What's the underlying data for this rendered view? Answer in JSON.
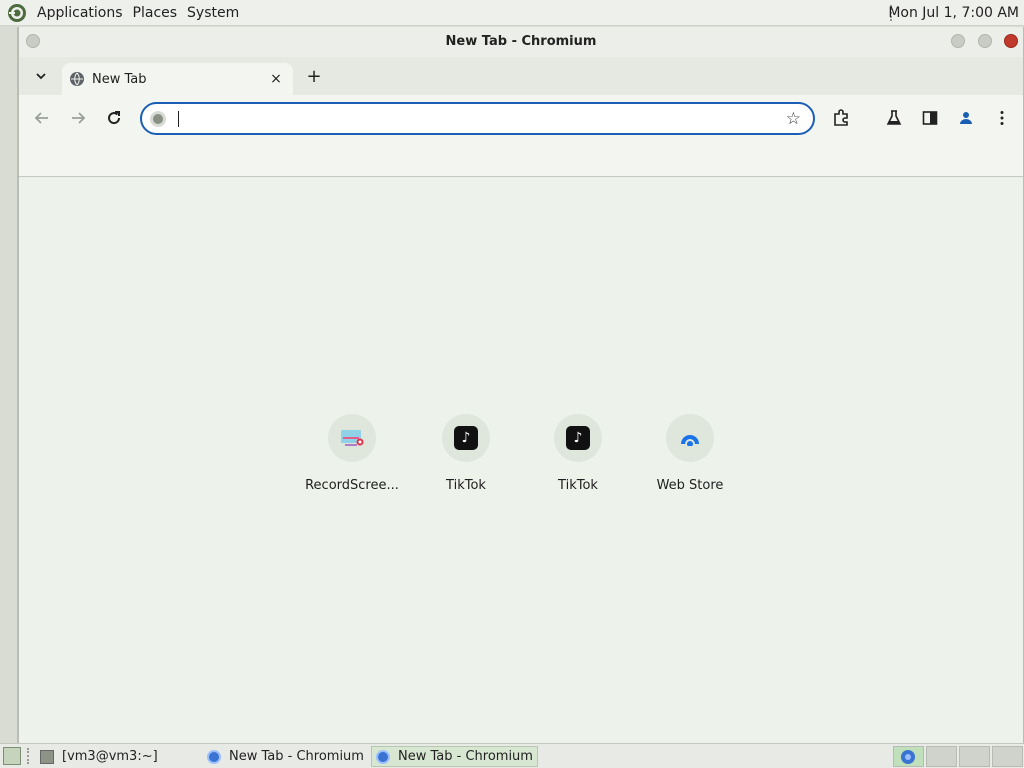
{
  "top_panel": {
    "menus": [
      "Applications",
      "Places",
      "System"
    ],
    "clock": "Mon Jul  1,  7:00 AM"
  },
  "window": {
    "title": "New Tab - Chromium"
  },
  "tabs": [
    {
      "label": "New Tab",
      "close": "×"
    }
  ],
  "new_tab": "+",
  "toolbar": {
    "omnibox_value": "",
    "omnibox_placeholder": ""
  },
  "shortcuts": [
    {
      "label": "RecordScree...",
      "icon": "record-screen-icon"
    },
    {
      "label": "TikTok",
      "icon": "tiktok-icon"
    },
    {
      "label": "TikTok",
      "icon": "tiktok-icon"
    },
    {
      "label": "Web Store",
      "icon": "web-store-icon"
    }
  ],
  "taskbar": {
    "tasks": [
      "[vm3@vm3:~]",
      "New Tab - Chromium",
      "New Tab - Chromium"
    ]
  },
  "colors": {
    "accent": "#1a5fb4",
    "page_bg": "#edf3eb",
    "close_button": "#c0392b"
  }
}
